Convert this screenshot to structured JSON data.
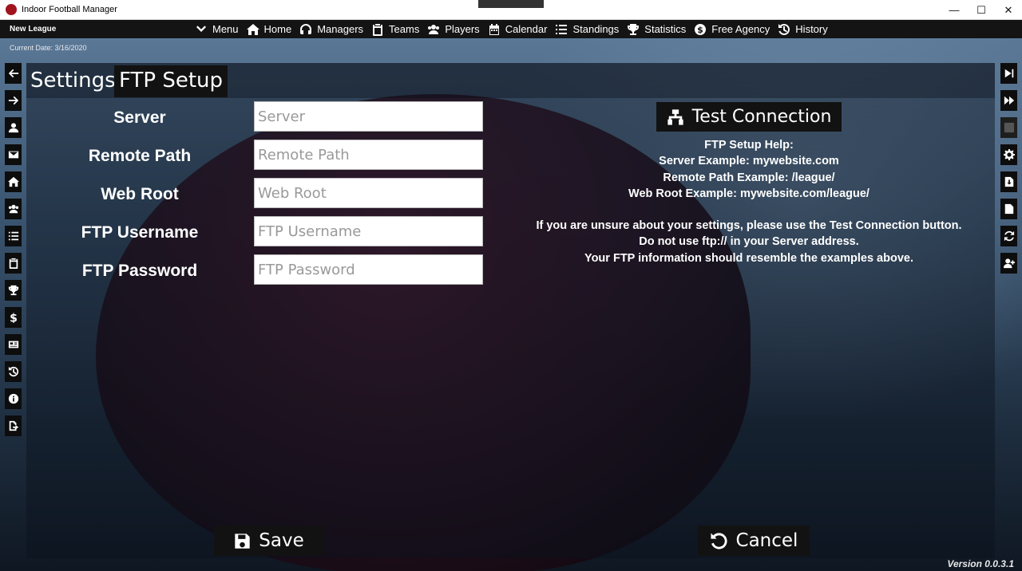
{
  "window": {
    "title": "Indoor Football Manager",
    "minimize": "—",
    "maximize": "☐",
    "close": "✕"
  },
  "navbar": {
    "league_name": "New League",
    "items": [
      {
        "label": "Menu",
        "icon": "chevron-down-icon"
      },
      {
        "label": "Home",
        "icon": "home-icon"
      },
      {
        "label": "Managers",
        "icon": "headset-icon"
      },
      {
        "label": "Teams",
        "icon": "clipboard-icon"
      },
      {
        "label": "Players",
        "icon": "users-icon"
      },
      {
        "label": "Calendar",
        "icon": "calendar-icon"
      },
      {
        "label": "Standings",
        "icon": "list-icon"
      },
      {
        "label": "Statistics",
        "icon": "trophy-icon"
      },
      {
        "label": "Free Agency",
        "icon": "dollar-icon"
      },
      {
        "label": "History",
        "icon": "history-icon"
      }
    ]
  },
  "current_date": "Current Date: 3/16/2020",
  "left_sidebar": [
    "arrow-left-icon",
    "arrow-right-icon",
    "user-icon",
    "envelope-icon",
    "home-icon",
    "users-icon",
    "list-icon",
    "clipboard-icon",
    "trophy-icon",
    "dollar-icon",
    "id-card-icon",
    "history-icon",
    "info-icon",
    "file-export-icon"
  ],
  "right_sidebar": [
    "step-forward-icon",
    "fast-forward-icon",
    "blank-icon",
    "gear-icon",
    "file-download-icon",
    "file-import-icon",
    "sync-icon",
    "add-user-icon"
  ],
  "page": {
    "title": "Settings",
    "subtitle": "FTP Setup"
  },
  "form": {
    "server": {
      "label": "Server",
      "placeholder": "Server",
      "value": ""
    },
    "remote_path": {
      "label": "Remote Path",
      "placeholder": "Remote Path",
      "value": ""
    },
    "web_root": {
      "label": "Web Root",
      "placeholder": "Web Root",
      "value": ""
    },
    "ftp_username": {
      "label": "FTP Username",
      "placeholder": "FTP Username",
      "value": ""
    },
    "ftp_password": {
      "label": "FTP Password",
      "placeholder": "FTP Password",
      "value": ""
    }
  },
  "test_connection_label": "Test Connection",
  "help": {
    "heading": "FTP Setup Help:",
    "server_example": "Server Example: mywebsite.com",
    "remote_path_example": "Remote Path Example: /league/",
    "web_root_example": "Web Root Example: mywebsite.com/league/",
    "note1": "If you are unsure about your settings, please use the Test Connection button.",
    "note2": "Do not use ftp:// in your Server address.",
    "note3": "Your FTP information should resemble the examples above."
  },
  "save_label": "Save",
  "cancel_label": "Cancel",
  "version": "Version 0.0.3.1"
}
